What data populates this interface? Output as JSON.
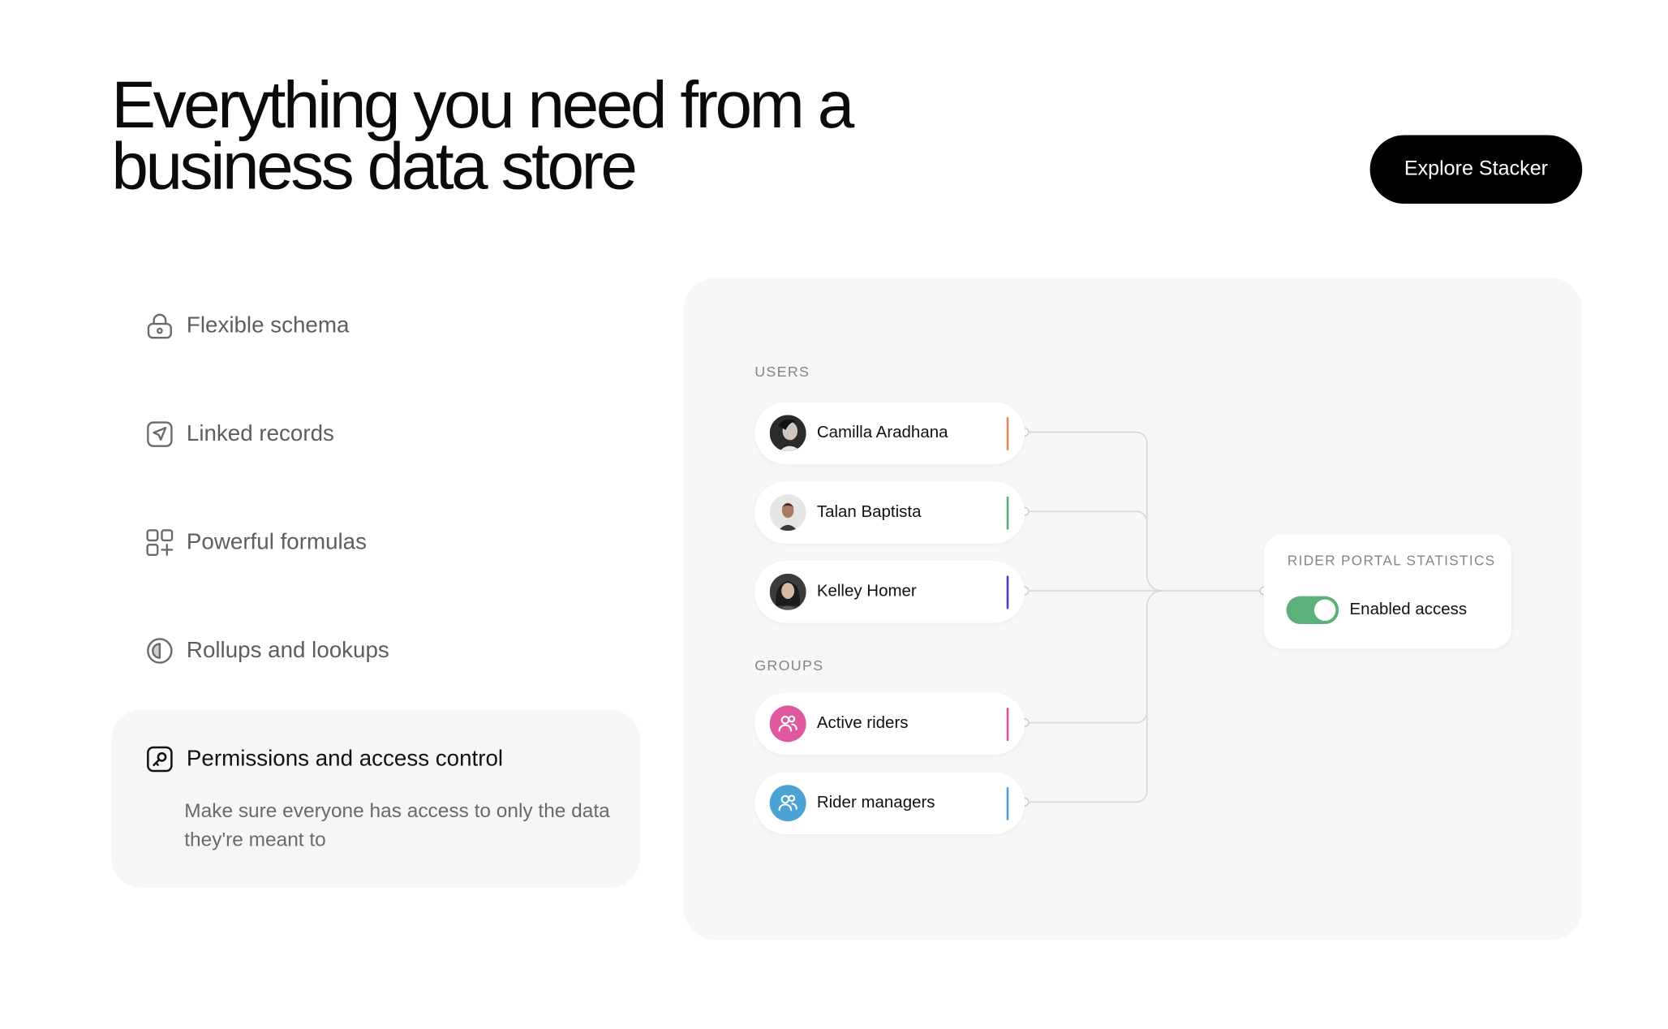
{
  "headline": {
    "line1": "Everything you need from a",
    "line2": "business data store"
  },
  "cta": {
    "label": "Explore Stacker"
  },
  "features": [
    {
      "label": "Flexible schema",
      "icon": "lock-icon"
    },
    {
      "label": "Linked records",
      "icon": "send-icon"
    },
    {
      "label": "Powerful formulas",
      "icon": "grid-plus-icon"
    },
    {
      "label": "Rollups and lookups",
      "icon": "half-circle-icon"
    },
    {
      "label": "Permissions and access control",
      "icon": "key-icon",
      "description": "Make sure everyone has access to only the data they're meant to",
      "active": true
    }
  ],
  "diagram": {
    "users_label": "USERS",
    "groups_label": "GROUPS",
    "users": [
      {
        "name": "Camilla Aradhana",
        "accent": "#d98a5c"
      },
      {
        "name": "Talan Baptista",
        "accent": "#5cb07a"
      },
      {
        "name": "Kelley Homer",
        "accent": "#4b3fc4"
      }
    ],
    "groups": [
      {
        "name": "Active riders",
        "accent": "#d6569b",
        "icon_color": "#e0589d"
      },
      {
        "name": "Rider managers",
        "accent": "#4aa3d4",
        "icon_color": "#4aa3d4"
      }
    ],
    "stats": {
      "title": "RIDER PORTAL STATISTICS",
      "toggle_label": "Enabled access",
      "toggle_on": true,
      "toggle_color": "#5cb07a"
    }
  }
}
